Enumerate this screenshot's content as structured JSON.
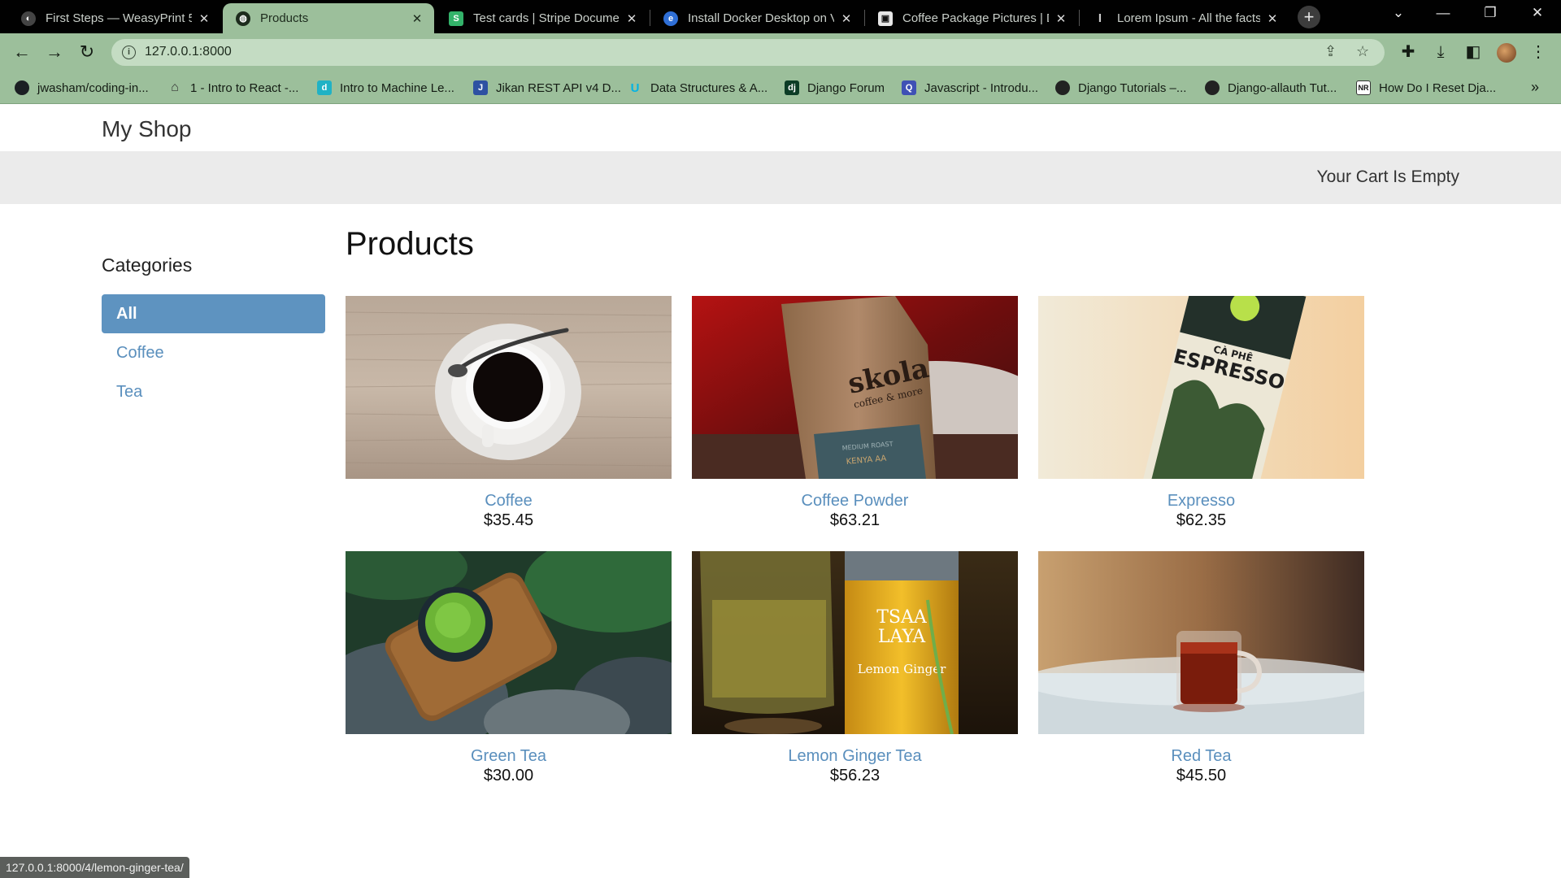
{
  "browser": {
    "tabs": [
      {
        "title": "First Steps — WeasyPrint 5",
        "active": false
      },
      {
        "title": "Products",
        "active": true
      },
      {
        "title": "Test cards | Stripe Documen",
        "active": false
      },
      {
        "title": "Install Docker Desktop on V",
        "active": false
      },
      {
        "title": "Coffee Package Pictures | D",
        "active": false
      },
      {
        "title": "Lorem Ipsum - All the facts",
        "active": false
      }
    ],
    "tab_close": "✕",
    "new_tab": "+",
    "window_controls": {
      "tab_search": "⌄",
      "minimize": "—",
      "restore": "❐",
      "close": "✕"
    },
    "url": "127.0.0.1:8000",
    "bookmarks": [
      {
        "label": "jwasham/coding-in...",
        "icon": "github-icon",
        "color": "#1b1f23"
      },
      {
        "label": "1 - Intro to React -...",
        "icon": "building-icon",
        "color": "#555555"
      },
      {
        "label": "Intro to Machine Le...",
        "icon": "d-logo-icon",
        "color": "#20b2c5"
      },
      {
        "label": "Jikan REST API v4 D...",
        "icon": "jikan-icon",
        "color": "#2e51a2"
      },
      {
        "label": "Data Structures & A...",
        "icon": "u-logo-icon",
        "color": "#02b3e4"
      },
      {
        "label": "Django Forum",
        "icon": "django-icon",
        "color": "#0c3c26"
      },
      {
        "label": "Javascript - Introdu...",
        "icon": "q-logo-icon",
        "color": "#3f51b5"
      },
      {
        "label": "Django Tutorials –...",
        "icon": "python-icon",
        "color": "#222222"
      },
      {
        "label": "Django-allauth Tut...",
        "icon": "globe-icon",
        "color": "#222222"
      },
      {
        "label": "How Do I Reset Dja...",
        "icon": "nr-logo-icon",
        "color": "#333333"
      }
    ],
    "bookmark_glyphs": [
      "",
      "⌂",
      "d",
      "J",
      "U",
      "dj",
      "Q",
      "",
      "",
      "NR"
    ],
    "bookmarks_more": "»",
    "status_url": "127.0.0.1:8000/4/lemon-ginger-tea/"
  },
  "site": {
    "title": "My Shop",
    "cart": "Your Cart Is Empty"
  },
  "sidebar": {
    "heading": "Categories",
    "items": [
      {
        "label": "All",
        "active": true
      },
      {
        "label": "Coffee",
        "active": false
      },
      {
        "label": "Tea",
        "active": false
      }
    ]
  },
  "main": {
    "heading": "Products",
    "products": [
      {
        "name": "Coffee",
        "price": "$35.45"
      },
      {
        "name": "Coffee Powder",
        "price": "$63.21"
      },
      {
        "name": "Expresso",
        "price": "$62.35"
      },
      {
        "name": "Green Tea",
        "price": "$30.00"
      },
      {
        "name": "Lemon Ginger Tea",
        "price": "$56.23"
      },
      {
        "name": "Red Tea",
        "price": "$45.50"
      }
    ],
    "image_text": {
      "coffee_powder_brand": "skola",
      "coffee_powder_tagline": "coffee & more",
      "coffee_powder_roast": "MEDIUM ROAST",
      "coffee_powder_origin": "KENYA AA",
      "expresso_line1": "CÀ PHÊ",
      "expresso_line2": "ESPRESSO",
      "lemon_brand_1": "TSAA",
      "lemon_brand_2": "LAYA",
      "lemon_label": "Lemon Ginger"
    }
  },
  "colors": {
    "chrome_green": "#9cbf9b",
    "link_blue": "#5a8fbd",
    "active_category": "#5e93c0"
  }
}
